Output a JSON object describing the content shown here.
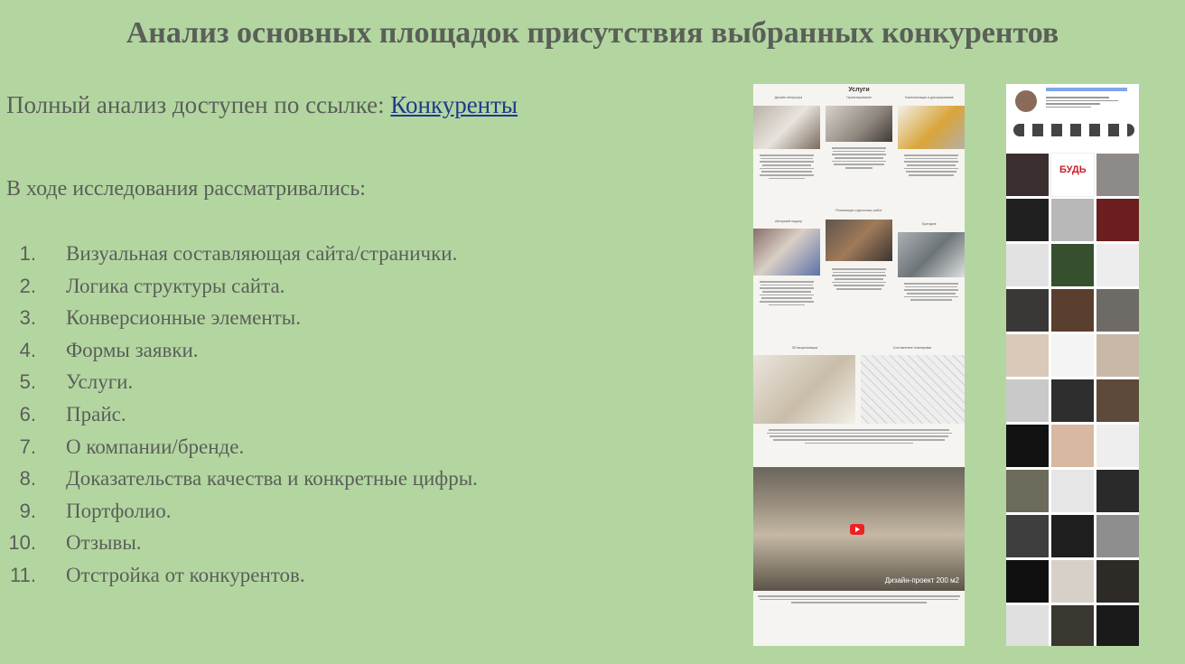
{
  "title": "Анализ основных площадок присутствия выбранных конкурентов",
  "intro": {
    "text": "Полный анализ доступен по ссылке: ",
    "link": "Конкуренты"
  },
  "subheading": "В ходе исследования рассматривались:",
  "items": [
    {
      "num": "1.",
      "text": "Визуальная составляющая сайта/странички."
    },
    {
      "num": "2.",
      "text": "Логика структуры сайта."
    },
    {
      "num": "3.",
      "text": "Конверсионные элементы."
    },
    {
      "num": "4.",
      "text": "Формы заявки."
    },
    {
      "num": "5.",
      "text": "Услуги."
    },
    {
      "num": "6.",
      "text": "Прайс."
    },
    {
      "num": "7.",
      "text": "О компании/бренде."
    },
    {
      "num": "8.",
      "text": "Доказательства качества и конкретные цифры."
    },
    {
      "num": "9.",
      "text": "Портфолио."
    },
    {
      "num": "10.",
      "text": "Отзывы."
    },
    {
      "num": "11.",
      "text": "Отстройка от конкурентов."
    }
  ],
  "site_screenshot": {
    "heading": "Услуги",
    "captions": [
      "Дизайн интерьера",
      "Проектирование",
      "Комплектация и декорирование"
    ],
    "section2": "Реализация отделочных работ",
    "captions2": [
      "Авторский надзор",
      "Брендинг"
    ],
    "captions3": [
      "3D визуализация",
      "Составление планировки"
    ],
    "video_label": "Дизайн-проект 200 м2"
  },
  "insta_screenshot": {
    "tile_text": [
      "БУДЬ"
    ]
  }
}
